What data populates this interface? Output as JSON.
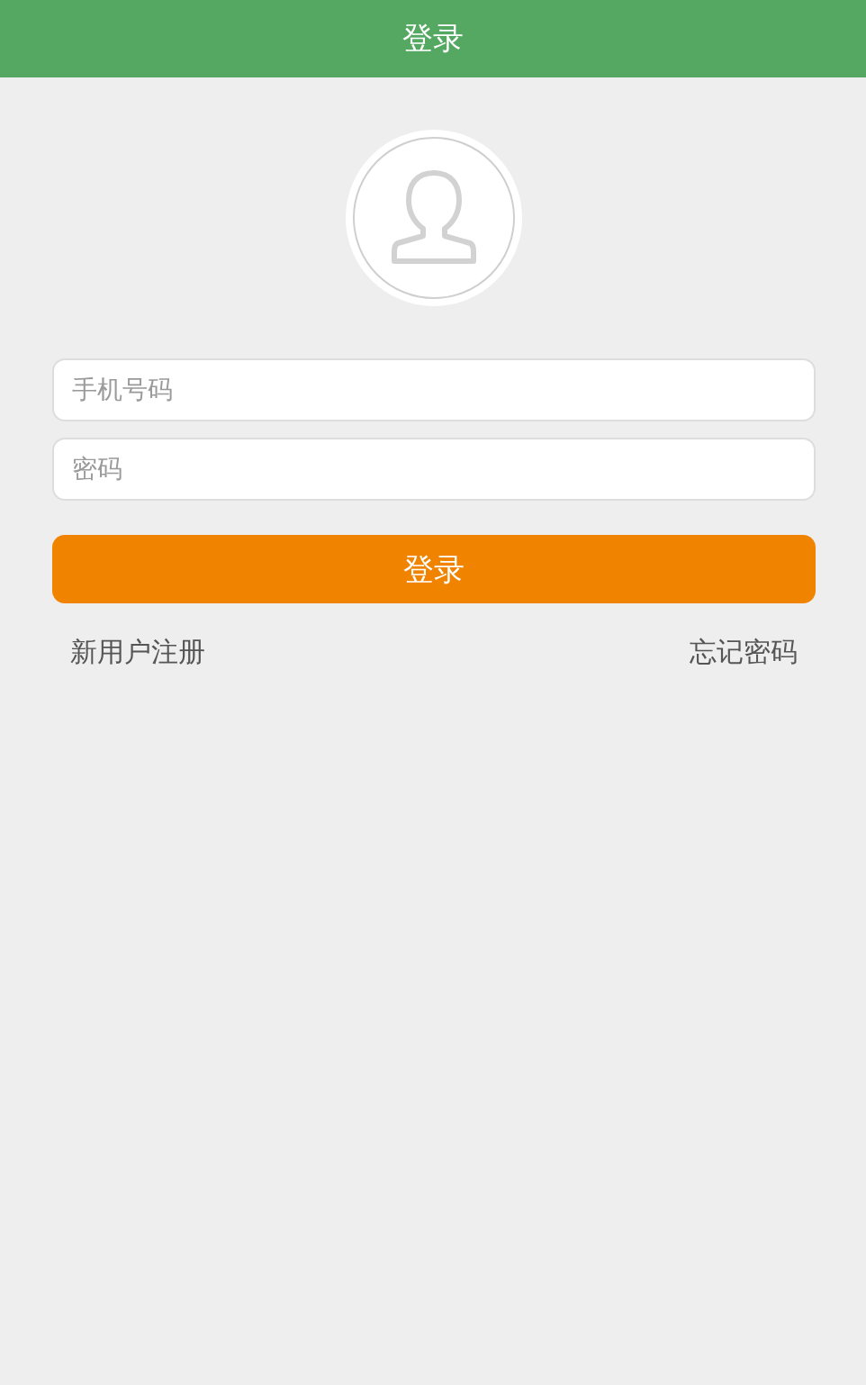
{
  "header": {
    "title": "登录"
  },
  "fields": [
    {
      "placeholder": "手机号码"
    },
    {
      "placeholder": "密码"
    }
  ],
  "login_button": "登录",
  "links": {
    "register": "新用户注册",
    "forgot_password": "忘记密码"
  }
}
